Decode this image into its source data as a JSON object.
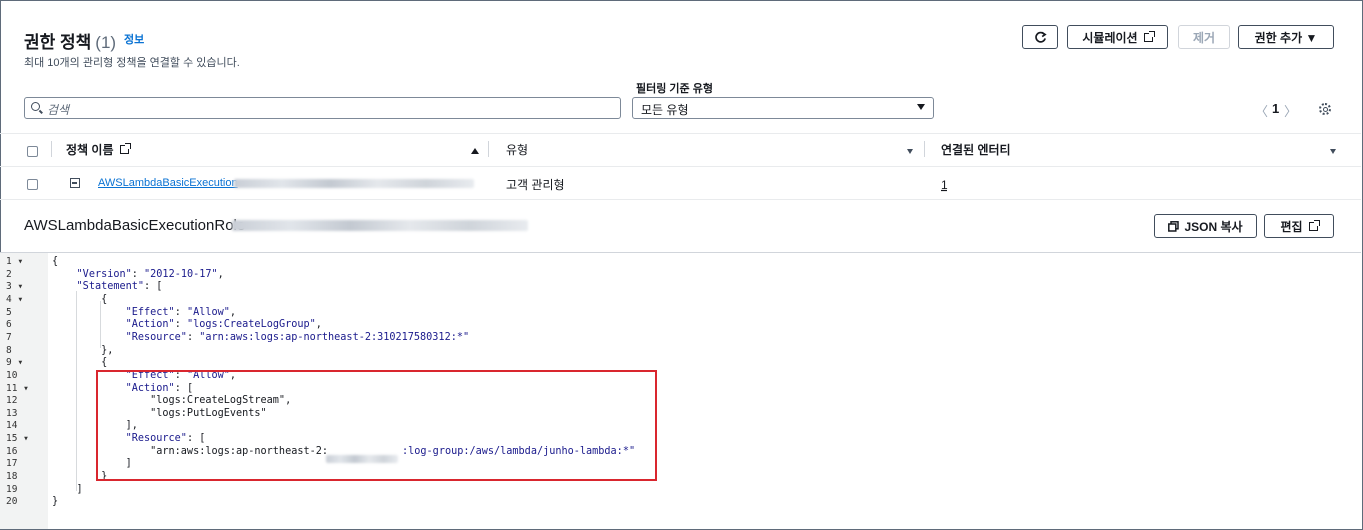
{
  "header": {
    "title": "권한 정책",
    "count": "(1)",
    "info": "정보",
    "subtitle": "최대 10개의 관리형 정책을 연결할 수 있습니다."
  },
  "toolbar": {
    "refresh_icon": "refresh-icon",
    "simulate": "시뮬레이션",
    "remove": "제거",
    "add_permissions": "권한 추가 ▼"
  },
  "filter": {
    "label": "필터링 기준 유형",
    "search_placeholder": "검색",
    "type_value": "모든 유형"
  },
  "pagination": {
    "prev": "〈",
    "page": "1",
    "next": "〉"
  },
  "table": {
    "columns": [
      "정책 이름",
      "유형",
      "연결된 엔터티"
    ],
    "rows": [
      {
        "name": "AWSLambdaBasicExecution",
        "type": "고객 관리형",
        "entities": "1"
      }
    ]
  },
  "detail": {
    "title": "AWSLambdaBasicExecutionRole",
    "copy_json": "JSON 복사",
    "edit": "편집"
  },
  "editor": {
    "line_numbers": [
      "1",
      "2",
      "3",
      "4",
      "5",
      "6",
      "7",
      "8",
      "9",
      "10",
      "11",
      "12",
      "13",
      "14",
      "15",
      "16",
      "17",
      "18",
      "19",
      "20"
    ],
    "lines": [
      "{",
      "    \"Version\": \"2012-10-17\",",
      "    \"Statement\": [",
      "        {",
      "            \"Effect\": \"Allow\",",
      "            \"Action\": \"logs:CreateLogGroup\",",
      "            \"Resource\": \"arn:aws:logs:ap-northeast-2:310217580312:*\"",
      "        },",
      "        {",
      "            \"Effect\": \"Allow\",",
      "            \"Action\": [",
      "                \"logs:CreateLogStream\",",
      "                \"logs:PutLogEvents\"",
      "            ],",
      "            \"Resource\": [",
      "                \"arn:aws:logs:ap-northeast-2:",
      "            ]",
      "        }",
      "    ]",
      "}"
    ],
    "line16_suffix": ":log-group:/aws/lambda/junho-lambda:*\""
  },
  "colors": {
    "link": "#0972d3",
    "highlight_box": "#d9262e",
    "text": "#16191f"
  }
}
